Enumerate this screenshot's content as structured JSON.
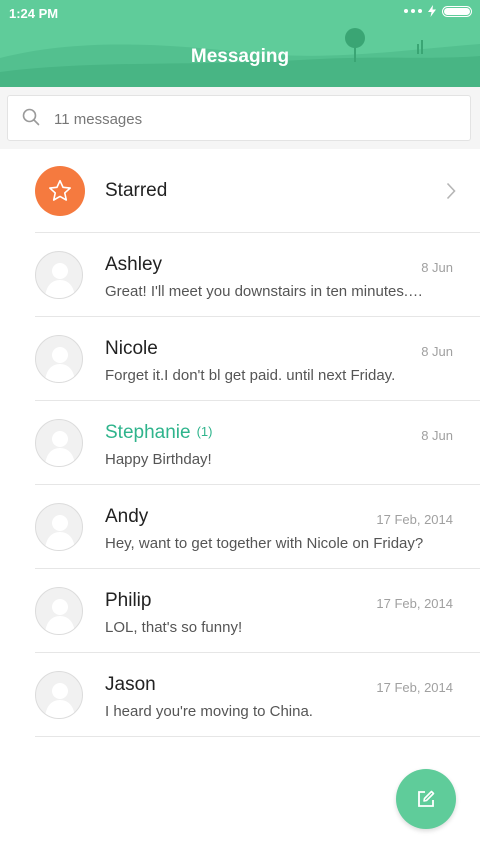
{
  "status_bar": {
    "time": "1:24 PM"
  },
  "header": {
    "title": "Messaging"
  },
  "search": {
    "placeholder": "11 messages"
  },
  "starred": {
    "label": "Starred"
  },
  "conversations": [
    {
      "name": "Ashley",
      "date": "8 Jun",
      "preview": "Great! I'll meet you downstairs in ten minutes.…",
      "unread": ""
    },
    {
      "name": "Nicole",
      "date": "8 Jun",
      "preview": "Forget it.I don't bl get paid. until next Friday.",
      "unread": ""
    },
    {
      "name": "Stephanie",
      "date": "8 Jun",
      "preview": "Happy Birthday!",
      "unread": "(1)"
    },
    {
      "name": "Andy",
      "date": "17 Feb, 2014",
      "preview": "Hey, want to get together with Nicole on Friday?",
      "unread": ""
    },
    {
      "name": "Philip",
      "date": "17 Feb, 2014",
      "preview": "LOL, that's so funny!",
      "unread": ""
    },
    {
      "name": "Jason",
      "date": "17 Feb, 2014",
      "preview": "I heard you're moving to China.",
      "unread": ""
    }
  ],
  "icons": {
    "search": "search-icon",
    "starred": "star-icon",
    "chevron": "chevron-right-icon",
    "compose": "compose-icon",
    "avatar": "person-icon",
    "battery": "battery-icon",
    "charging": "charging-icon"
  },
  "colors": {
    "header": "#5fcc9a",
    "accent": "#2fb48c",
    "starred": "#f57a3f"
  }
}
